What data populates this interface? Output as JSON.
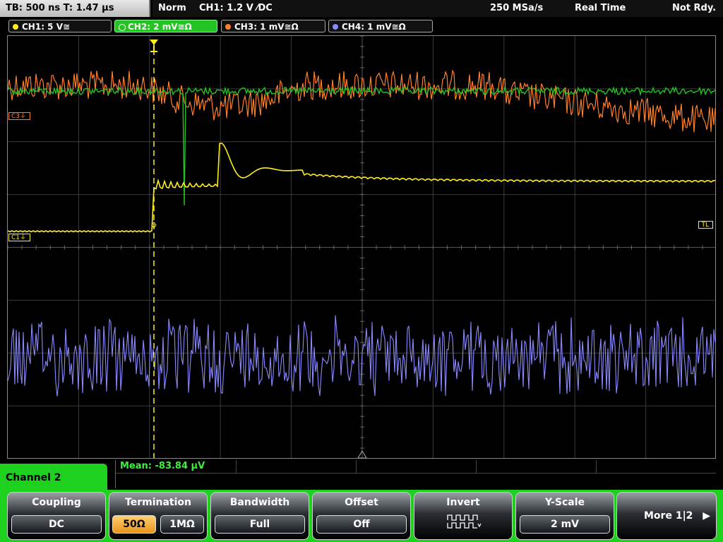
{
  "status": {
    "timebase": "TB: 500 ns   T: 1.47 µs",
    "mode": "Norm",
    "trigger": "CH1: 1.2 V ⁄DC",
    "samplerate": "250 MSa/s",
    "realtime": "Real Time",
    "ready": "Not Rdy."
  },
  "channels": [
    {
      "label": "CH1: 5 V≅",
      "color": "#ffee22"
    },
    {
      "label": "CH2: 2 mV≅Ω",
      "color": "#22c322"
    },
    {
      "label": "CH3: 1 mV≅Ω",
      "color": "#ff7f2a"
    },
    {
      "label": "CH4: 1 mV≅Ω",
      "color": "#8a8aff"
    }
  ],
  "markers": {
    "c3": "C3⏚",
    "c1": "C1⏚",
    "tl": "TL"
  },
  "measurement": {
    "mean": "Mean: -83.84 µV"
  },
  "menu": {
    "channel_title": "Channel 2",
    "coupling": {
      "title": "Coupling",
      "value": "DC"
    },
    "termination": {
      "title": "Termination",
      "opt1": "50Ω",
      "opt2": "1MΩ"
    },
    "bandwidth": {
      "title": "Bandwidth",
      "value": "Full"
    },
    "offset": {
      "title": "Offset",
      "value": "Off"
    },
    "invert": {
      "title": "Invert"
    },
    "yscale": {
      "title": "Y-Scale",
      "value": "2 mV"
    },
    "more": {
      "label": "More 1|2"
    }
  },
  "colors": {
    "ch1": "#ffee22",
    "ch2": "#22c322",
    "ch3": "#ff7f2a",
    "ch4": "#8a8aff",
    "accent": "#1fd11f"
  }
}
